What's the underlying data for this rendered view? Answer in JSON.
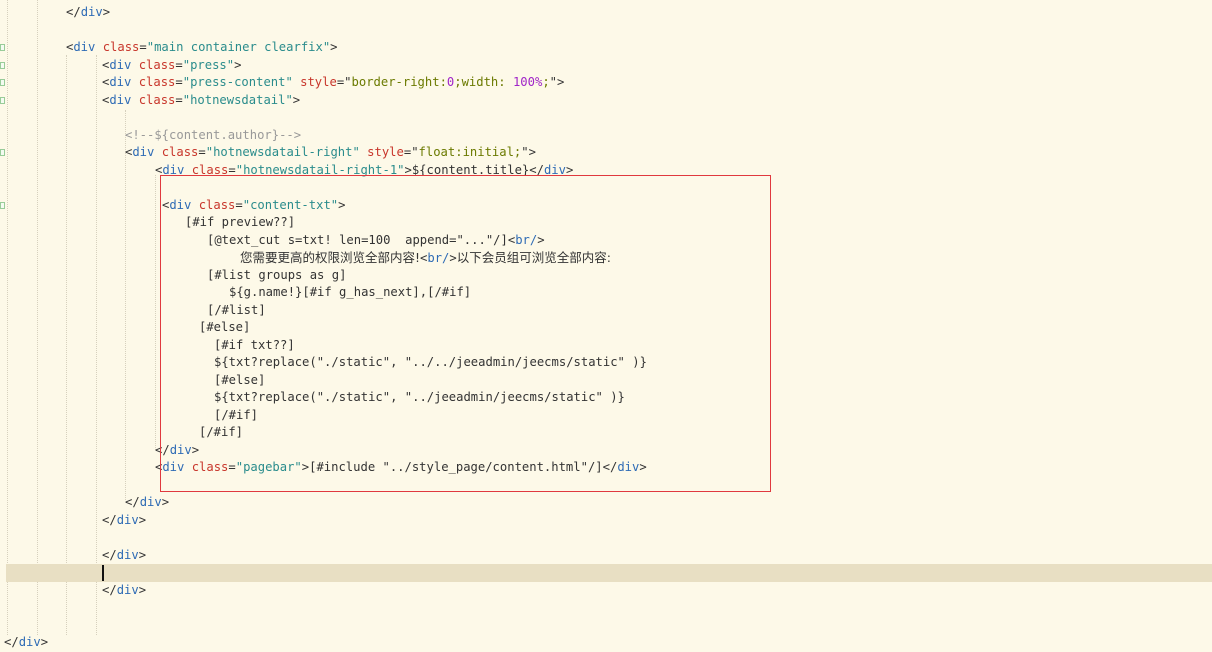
{
  "editor": {
    "cursor_line": 32,
    "lines": [
      {
        "n": 0,
        "tokens": [
          {
            "c": "br",
            "v": "</"
          },
          {
            "c": "tag",
            "v": "div"
          },
          {
            "c": "br",
            "v": ">"
          }
        ]
      },
      {
        "n": 2,
        "tokens": [
          {
            "c": "br",
            "v": "<"
          },
          {
            "c": "tag",
            "v": "div"
          },
          {
            "c": "attr",
            "v": " class"
          },
          {
            "c": "br",
            "v": "="
          },
          {
            "c": "str",
            "v": "\"main container clearfix\""
          },
          {
            "c": "br",
            "v": ">"
          }
        ]
      },
      {
        "n": 3,
        "tokens": [
          {
            "c": "br",
            "v": "<"
          },
          {
            "c": "tag",
            "v": "div"
          },
          {
            "c": "attr",
            "v": " class"
          },
          {
            "c": "br",
            "v": "="
          },
          {
            "c": "str",
            "v": "\"press\""
          },
          {
            "c": "br",
            "v": ">"
          }
        ]
      },
      {
        "n": 4,
        "tokens": [
          {
            "c": "br",
            "v": "<"
          },
          {
            "c": "tag",
            "v": "div"
          },
          {
            "c": "attr",
            "v": " class"
          },
          {
            "c": "br",
            "v": "="
          },
          {
            "c": "str",
            "v": "\"press-content\""
          },
          {
            "c": "attr",
            "v": " style"
          },
          {
            "c": "br",
            "v": "=\""
          },
          {
            "c": "val",
            "v": "border-right:"
          },
          {
            "c": "num",
            "v": "0"
          },
          {
            "c": "val",
            "v": ";width: "
          },
          {
            "c": "num",
            "v": "100%"
          },
          {
            "c": "val",
            "v": ";"
          },
          {
            "c": "br",
            "v": "\">"
          }
        ]
      },
      {
        "n": 5,
        "tokens": [
          {
            "c": "br",
            "v": "<"
          },
          {
            "c": "tag",
            "v": "div"
          },
          {
            "c": "attr",
            "v": " class"
          },
          {
            "c": "br",
            "v": "="
          },
          {
            "c": "str",
            "v": "\"hotnewsdatail\""
          },
          {
            "c": "br",
            "v": ">"
          }
        ]
      },
      {
        "n": 7,
        "tokens": [
          {
            "c": "com",
            "v": "<!--${content.author}-->"
          }
        ]
      },
      {
        "n": 8,
        "tokens": [
          {
            "c": "br",
            "v": "<"
          },
          {
            "c": "tag",
            "v": "div"
          },
          {
            "c": "attr",
            "v": " class"
          },
          {
            "c": "br",
            "v": "="
          },
          {
            "c": "str",
            "v": "\"hotnewsdatail-right\""
          },
          {
            "c": "attr",
            "v": " style"
          },
          {
            "c": "br",
            "v": "=\""
          },
          {
            "c": "val",
            "v": "float:initial;"
          },
          {
            "c": "br",
            "v": "\">"
          }
        ]
      },
      {
        "n": 9,
        "tokens": [
          {
            "c": "br",
            "v": "<"
          },
          {
            "c": "tag",
            "v": "div"
          },
          {
            "c": "attr",
            "v": " class"
          },
          {
            "c": "br",
            "v": "="
          },
          {
            "c": "str",
            "v": "\"hotnewsdatail-right-1\""
          },
          {
            "c": "br",
            "v": ">"
          },
          {
            "c": "txt",
            "v": "${content.title}"
          },
          {
            "c": "br",
            "v": "</"
          },
          {
            "c": "tag",
            "v": "div"
          },
          {
            "c": "br",
            "v": ">"
          }
        ]
      },
      {
        "n": 11,
        "tokens": [
          {
            "c": "br",
            "v": "<"
          },
          {
            "c": "tag",
            "v": "div"
          },
          {
            "c": "attr",
            "v": " class"
          },
          {
            "c": "br",
            "v": "="
          },
          {
            "c": "str",
            "v": "\"content-txt\""
          },
          {
            "c": "br",
            "v": ">"
          }
        ]
      },
      {
        "n": 12,
        "tokens": [
          {
            "c": "txt",
            "v": "[#if preview??]"
          }
        ]
      },
      {
        "n": 13,
        "tokens": [
          {
            "c": "txt",
            "v": "[@text_cut s=txt! len=100  append=\"...\"/]"
          },
          {
            "c": "br",
            "v": "<"
          },
          {
            "c": "tag",
            "v": "br/"
          },
          {
            "c": "br",
            "v": ">"
          }
        ]
      },
      {
        "n": 14,
        "tokens": [
          {
            "c": "cn",
            "v": "您需要更高的权限浏览全部内容!"
          },
          {
            "c": "br",
            "v": "<"
          },
          {
            "c": "tag",
            "v": "br/"
          },
          {
            "c": "br",
            "v": ">"
          },
          {
            "c": "cn",
            "v": "以下会员组可浏览全部内容:"
          }
        ]
      },
      {
        "n": 15,
        "tokens": [
          {
            "c": "txt",
            "v": "[#list groups as g]"
          }
        ]
      },
      {
        "n": 16,
        "tokens": [
          {
            "c": "txt",
            "v": "${g.name!}[#if g_has_next],[/#if]"
          }
        ]
      },
      {
        "n": 17,
        "tokens": [
          {
            "c": "txt",
            "v": "[/#list]"
          }
        ]
      },
      {
        "n": 18,
        "tokens": [
          {
            "c": "txt",
            "v": "[#else]"
          }
        ]
      },
      {
        "n": 19,
        "tokens": [
          {
            "c": "txt",
            "v": "[#if txt??]"
          }
        ]
      },
      {
        "n": 20,
        "tokens": [
          {
            "c": "txt",
            "v": "${txt?replace(\"./static\", \"../../jeeadmin/jeecms/static\" )}"
          }
        ]
      },
      {
        "n": 21,
        "tokens": [
          {
            "c": "txt",
            "v": "[#else]"
          }
        ]
      },
      {
        "n": 22,
        "tokens": [
          {
            "c": "txt",
            "v": "${txt?replace(\"./static\", \"../jeeadmin/jeecms/static\" )}"
          }
        ]
      },
      {
        "n": 23,
        "tokens": [
          {
            "c": "txt",
            "v": "[/#if]"
          }
        ]
      },
      {
        "n": 24,
        "tokens": [
          {
            "c": "txt",
            "v": "[/#if]"
          }
        ]
      },
      {
        "n": 25,
        "tokens": [
          {
            "c": "br",
            "v": "</"
          },
          {
            "c": "tag",
            "v": "div"
          },
          {
            "c": "br",
            "v": ">"
          }
        ]
      },
      {
        "n": 26,
        "tokens": [
          {
            "c": "br",
            "v": "<"
          },
          {
            "c": "tag",
            "v": "div"
          },
          {
            "c": "attr",
            "v": " class"
          },
          {
            "c": "br",
            "v": "="
          },
          {
            "c": "str",
            "v": "\"pagebar\""
          },
          {
            "c": "br",
            "v": ">"
          },
          {
            "c": "txt",
            "v": "[#include \"../style_page/content.html\"/]"
          },
          {
            "c": "br",
            "v": "</"
          },
          {
            "c": "tag",
            "v": "div"
          },
          {
            "c": "br",
            "v": ">"
          }
        ]
      },
      {
        "n": 28,
        "tokens": [
          {
            "c": "br",
            "v": "</"
          },
          {
            "c": "tag",
            "v": "div"
          },
          {
            "c": "br",
            "v": ">"
          }
        ]
      },
      {
        "n": 29,
        "tokens": [
          {
            "c": "br",
            "v": "</"
          },
          {
            "c": "tag",
            "v": "div"
          },
          {
            "c": "br",
            "v": ">"
          }
        ]
      },
      {
        "n": 31,
        "tokens": [
          {
            "c": "br",
            "v": "</"
          },
          {
            "c": "tag",
            "v": "div"
          },
          {
            "c": "br",
            "v": ">"
          }
        ]
      },
      {
        "n": 33,
        "tokens": [
          {
            "c": "br",
            "v": "</"
          },
          {
            "c": "tag",
            "v": "div"
          },
          {
            "c": "br",
            "v": ">"
          }
        ]
      },
      {
        "n": 36,
        "tokens": [
          {
            "c": "br",
            "v": "</"
          },
          {
            "c": "tag",
            "v": "div"
          },
          {
            "c": "br",
            "v": ">"
          }
        ]
      }
    ]
  },
  "annotation": {
    "color": "#e0393e"
  }
}
